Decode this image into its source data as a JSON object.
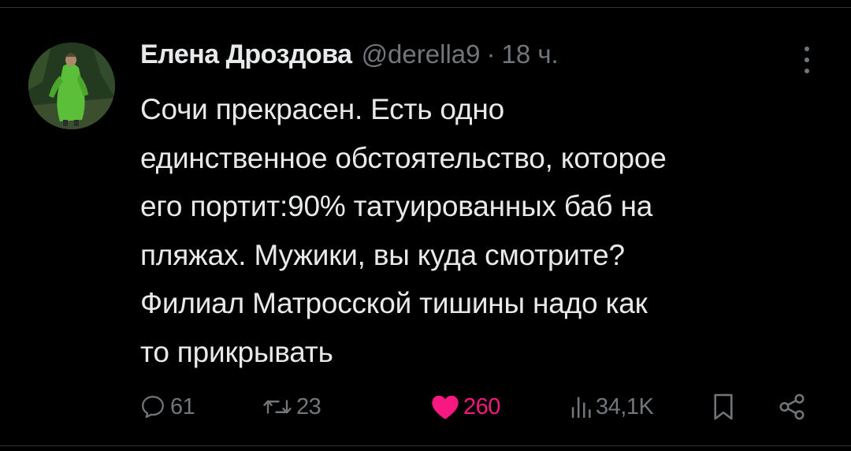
{
  "tweet": {
    "author_name": "Елена Дроздова",
    "author_handle": "@derella9",
    "separator": "·",
    "timestamp": "18 ч.",
    "text": "Сочи прекрасен. Есть одно\nединственное обстоятельство, которое\nего портит:90% татуированных баб на\nпляжах. Мужики, вы куда смотрите?\nФилиал Матросской тишины надо как\nто прикрывать",
    "avatar_icon": "avatar-green-coat-figure"
  },
  "actions": {
    "replies": "61",
    "retweets": "23",
    "likes": "260",
    "views": "34,1K",
    "icons": {
      "reply": "reply-icon",
      "retweet": "retweet-icon",
      "like": "heart-icon",
      "views": "views-icon",
      "bookmark": "bookmark-icon",
      "share": "share-icon",
      "more": "more-icon"
    }
  },
  "colors": {
    "background": "#000000",
    "text_primary": "#e7e9ea",
    "text_secondary": "#71767b",
    "like_active": "#f91880",
    "divider": "#2f3336"
  }
}
